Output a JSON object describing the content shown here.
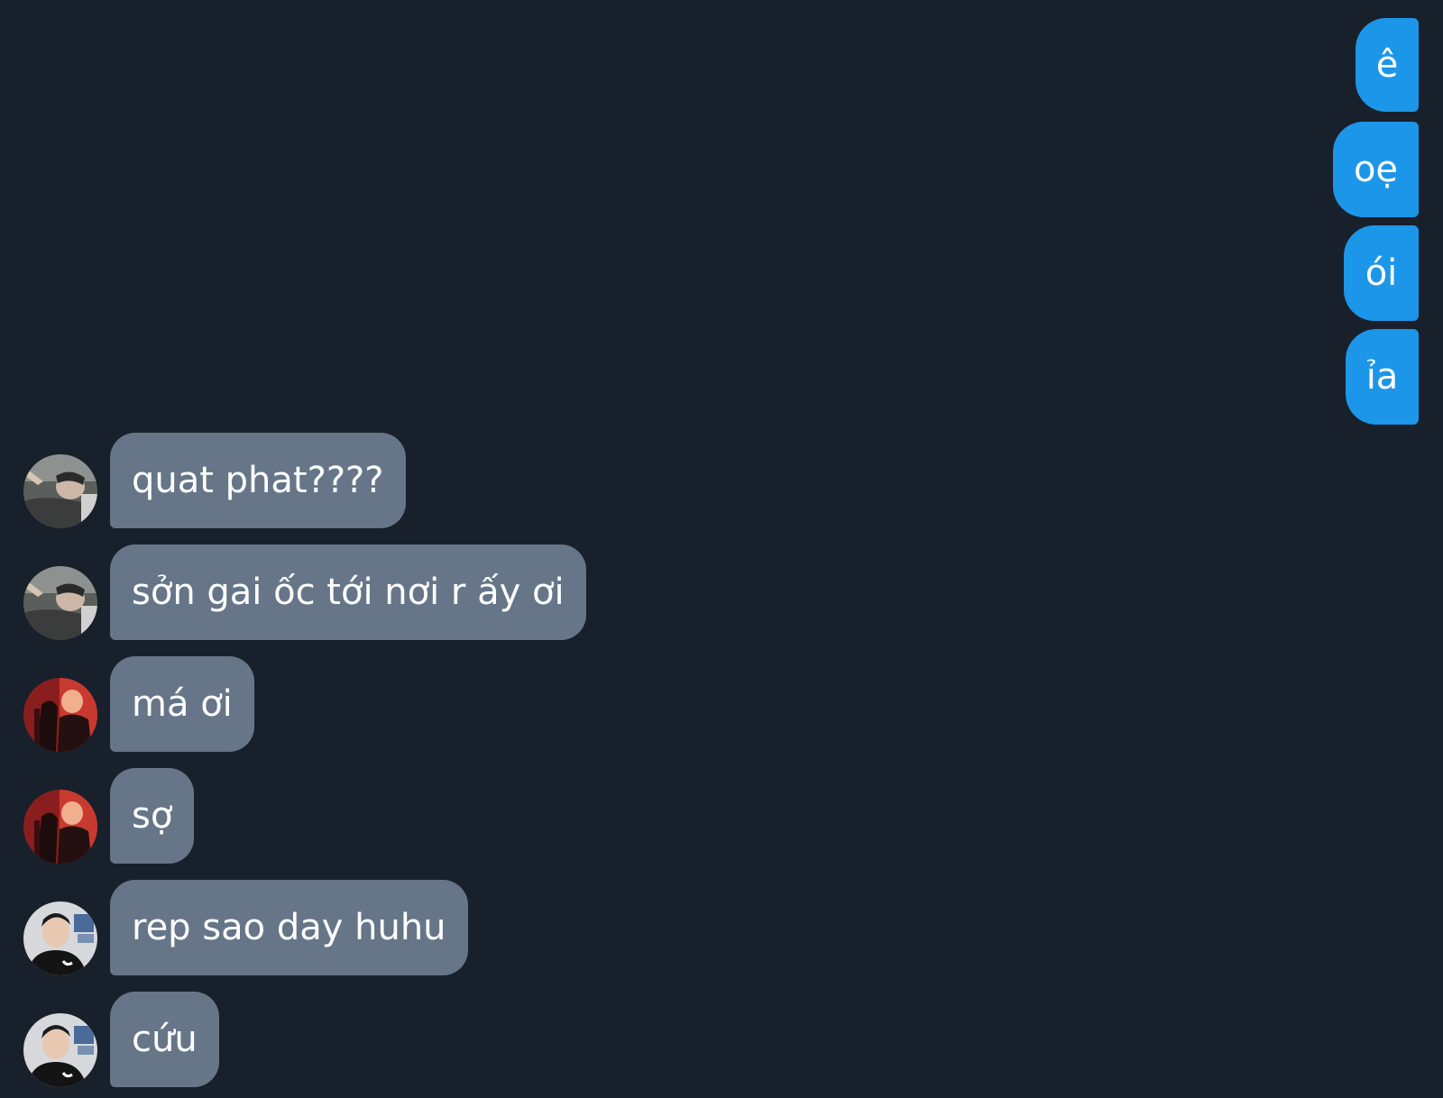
{
  "colors": {
    "background": "#18202b",
    "sent_bubble": "#1c96e8",
    "received_bubble": "#667688",
    "text": "#ffffff"
  },
  "sent_messages": [
    {
      "text": "ê"
    },
    {
      "text": "oẹ"
    },
    {
      "text": "ói"
    },
    {
      "text": "ỉa"
    }
  ],
  "received_messages": [
    {
      "text": "quat phat????",
      "avatar": "user-avatar-1"
    },
    {
      "text": "sởn gai ốc tới nơi r ấy ơi",
      "avatar": "user-avatar-1"
    },
    {
      "text": "má ơi",
      "avatar": "user-avatar-2"
    },
    {
      "text": "sợ",
      "avatar": "user-avatar-2"
    },
    {
      "text": "rep sao day huhu",
      "avatar": "user-avatar-3"
    },
    {
      "text": "cứu",
      "avatar": "user-avatar-3"
    }
  ]
}
